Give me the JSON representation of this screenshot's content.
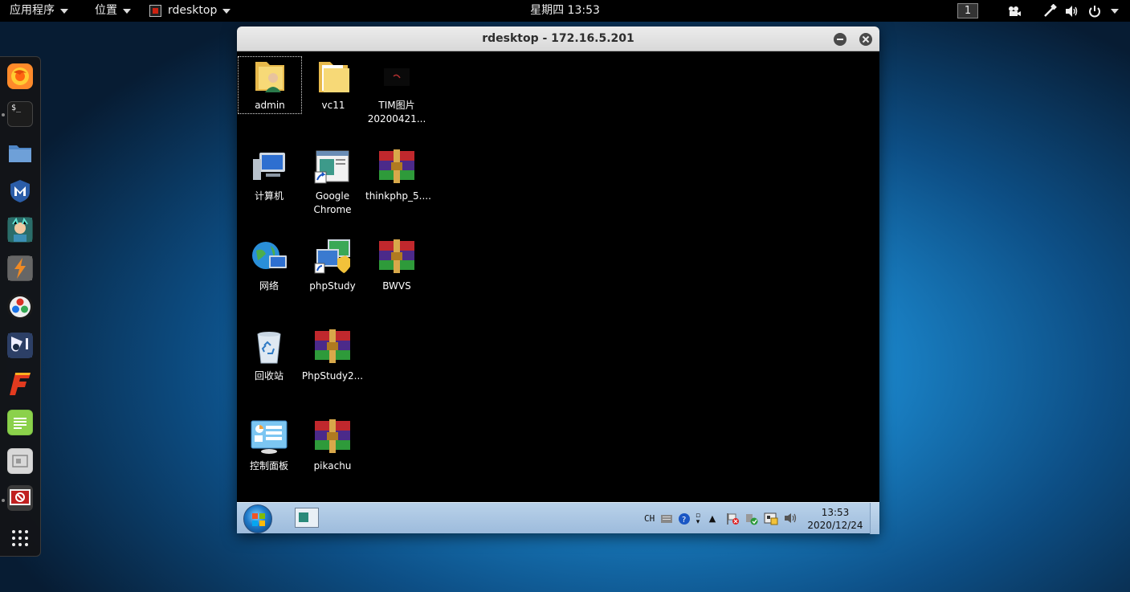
{
  "topbar": {
    "applications_label": "应用程序",
    "places_label": "位置",
    "app_label": "rdesktop",
    "clock": "星期四 13:53",
    "workspace": "1"
  },
  "dock": {
    "items": [
      {
        "name": "firefox",
        "color": "#ff7a1a"
      },
      {
        "name": "terminal",
        "color": "#222222"
      },
      {
        "name": "files",
        "color": "#4a7fbf"
      },
      {
        "name": "metasploit",
        "color": "#2b5da8"
      },
      {
        "name": "armitage",
        "color": "#3a8f7a"
      },
      {
        "name": "burpsuite",
        "color": "#e8732a"
      },
      {
        "name": "maltego",
        "color": "#1b1b1b"
      },
      {
        "name": "beef",
        "color": "#2f4a7a"
      },
      {
        "name": "faraday",
        "color": "#d9302b"
      },
      {
        "name": "text-editor",
        "color": "#7ac142"
      },
      {
        "name": "screenshot-tool",
        "color": "#bfbfbf"
      },
      {
        "name": "rdesktop",
        "color": "#c02020"
      }
    ],
    "terminal_glyph": "$_"
  },
  "window": {
    "title": "rdesktop - 172.16.5.201"
  },
  "desktop_icons": [
    {
      "label": "admin",
      "icon": "user-folder-icon"
    },
    {
      "label": "vc11",
      "icon": "folder-icon"
    },
    {
      "label": "TIM图片\n20200421...",
      "icon": "image-file-icon"
    },
    {
      "label": "计算机",
      "icon": "computer-icon"
    },
    {
      "label": "Google\nChrome",
      "icon": "chrome-shortcut-icon"
    },
    {
      "label": "thinkphp_5....",
      "icon": "winrar-archive-icon"
    },
    {
      "label": "网络",
      "icon": "network-icon"
    },
    {
      "label": "phpStudy",
      "icon": "phpstudy-icon"
    },
    {
      "label": "BWVS",
      "icon": "winrar-archive-icon"
    },
    {
      "label": "回收站",
      "icon": "recycle-bin-icon"
    },
    {
      "label": "PhpStudy2...",
      "icon": "winrar-archive-icon"
    },
    {
      "label": "控制面板",
      "icon": "control-panel-icon"
    },
    {
      "label": "pikachu",
      "icon": "winrar-archive-icon"
    }
  ],
  "win7_taskbar": {
    "lang": "CH",
    "time": "13:53",
    "date": "2020/12/24"
  },
  "colors": {
    "desktop_accent": "#1a84c9",
    "taskbar": "#b9d2ea"
  }
}
